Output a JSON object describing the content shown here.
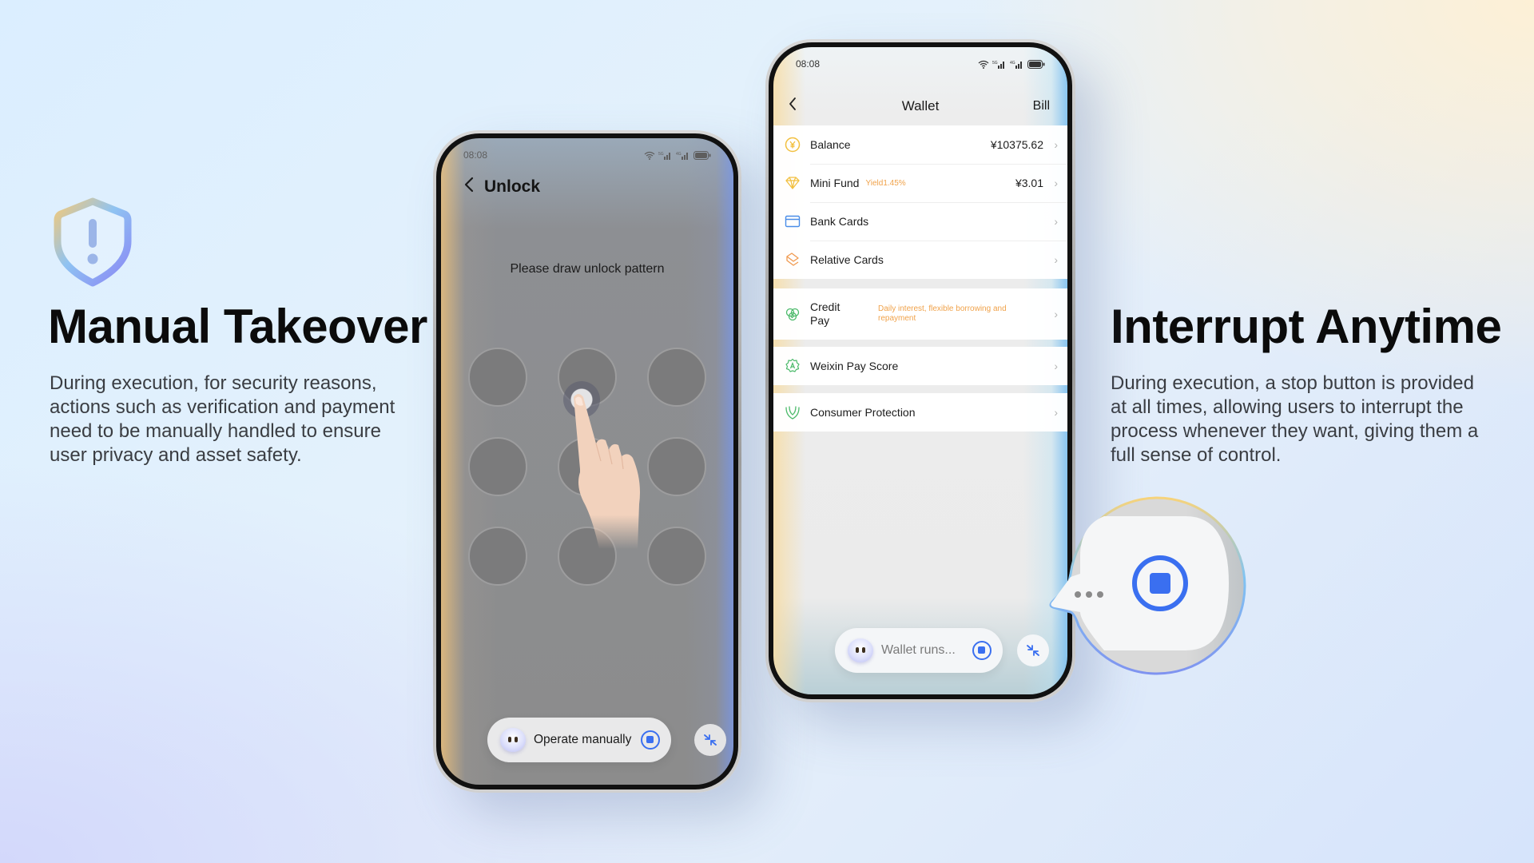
{
  "left_panel": {
    "icon": "shield-alert-icon",
    "title": "Manual Takeover",
    "description": "During execution, for security reasons, actions such as verification and payment need to be manually handled to ensure user privacy and asset safety."
  },
  "right_panel": {
    "title": "Interrupt Anytime",
    "description": "During execution, a stop button is provided at all times, allowing users to interrupt the process whenever they want, giving them a full sense of control."
  },
  "phone_unlock": {
    "status_time": "08:08",
    "status_icons": [
      "wifi-icon",
      "signal-5g-icon",
      "signal-4g-icon",
      "battery-icon"
    ],
    "signal_labels": [
      "5G",
      "4G"
    ],
    "back_icon": "chevron-left-icon",
    "title": "Unlock",
    "prompt": "Please draw unlock pattern",
    "pattern_dots": 9,
    "touched_dot": 2,
    "agent_pill": {
      "avatar": "robot-avatar-icon",
      "label": "Operate manually",
      "stop_icon": "stop-icon"
    },
    "collapse_icon": "collapse-arrows-icon"
  },
  "phone_wallet": {
    "status_time": "08:08",
    "status_icons": [
      "wifi-icon",
      "signal-5g-icon",
      "signal-4g-icon",
      "battery-icon"
    ],
    "signal_labels": [
      "5G",
      "4G"
    ],
    "header": {
      "back_icon": "chevron-left-icon",
      "title": "Wallet",
      "action": "Bill"
    },
    "groups": [
      {
        "items": [
          {
            "icon": "yen-coin-icon",
            "label": "Balance",
            "value": "¥10375.62"
          },
          {
            "icon": "diamond-icon",
            "label": "Mini Fund",
            "tag": "Yield1.45%",
            "value": "¥3.01"
          },
          {
            "icon": "bank-card-icon",
            "label": "Bank Cards"
          },
          {
            "icon": "relative-card-icon",
            "label": "Relative Cards"
          }
        ]
      },
      {
        "items": [
          {
            "icon": "credit-pay-icon",
            "label": "Credit Pay",
            "tag": "Daily interest, flexible borrowing and repayment"
          }
        ]
      },
      {
        "items": [
          {
            "icon": "pay-score-icon",
            "label": "Weixin Pay Score"
          }
        ]
      },
      {
        "items": [
          {
            "icon": "protection-hands-icon",
            "label": "Consumer Protection"
          }
        ]
      }
    ],
    "chevron": "›",
    "agent_pill": {
      "avatar": "robot-avatar-icon",
      "label": "Wallet runs...",
      "stop_icon": "stop-icon"
    },
    "collapse_icon": "collapse-arrows-icon"
  },
  "stop_bubble": {
    "icon": "stop-icon",
    "typing_indicator": "•••"
  },
  "colors": {
    "accent_blue": "#3a6ff0",
    "tag_orange": "#f0a24a",
    "title_text": "#0b0b0b",
    "body_text": "#3a3d42"
  }
}
